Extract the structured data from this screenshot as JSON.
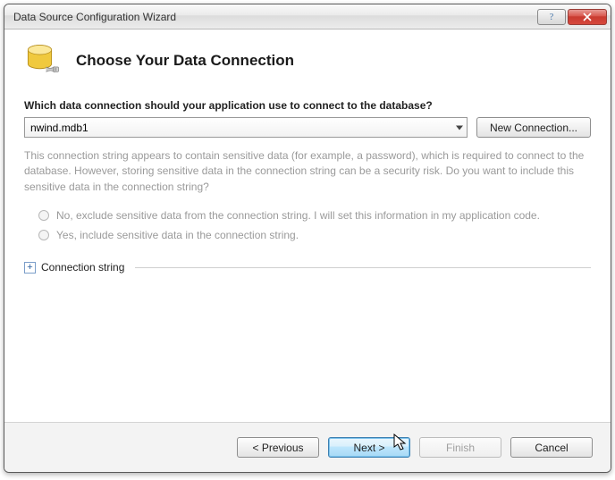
{
  "window": {
    "title": "Data Source Configuration Wizard"
  },
  "header": {
    "title": "Choose Your Data Connection"
  },
  "prompt": "Which data connection should your application use to connect to the database?",
  "connection": {
    "selected": "nwind.mdb1",
    "new_button": "New Connection..."
  },
  "sensitive": {
    "info": "This connection string appears to contain sensitive data (for example, a password), which is required to connect to the database. However, storing sensitive data in the connection string can be a security risk. Do you want to include this sensitive data in the connection string?",
    "option_exclude": "No, exclude sensitive data from the connection string. I will set this information in my application code.",
    "option_include": "Yes, include sensitive data in the connection string."
  },
  "expander": {
    "symbol": "+",
    "label": "Connection string"
  },
  "footer": {
    "previous": "< Previous",
    "next": "Next >",
    "finish": "Finish",
    "cancel": "Cancel"
  }
}
